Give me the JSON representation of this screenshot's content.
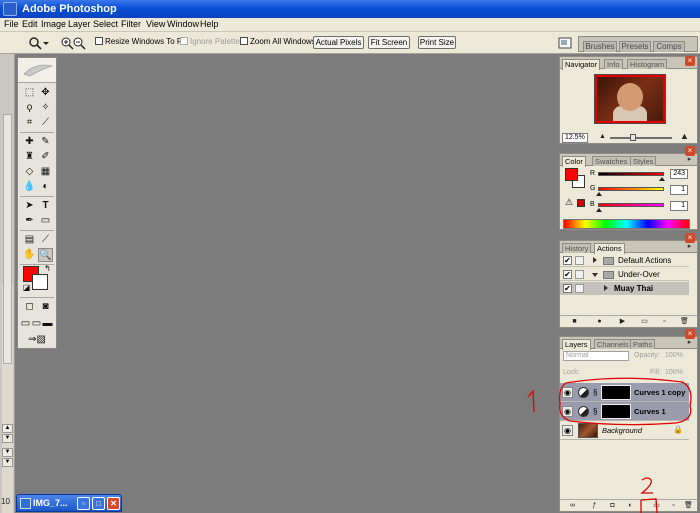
{
  "titlebar": {
    "title": "Adobe Photoshop"
  },
  "menu": [
    "File",
    "Edit",
    "Image",
    "Layer",
    "Select",
    "Filter",
    "View",
    "Window",
    "Help"
  ],
  "options": {
    "resize_windows": "Resize Windows To Fit",
    "ignore_palettes": "Ignore Palettes",
    "zoom_all": "Zoom All Windows",
    "actual_pixels": "Actual Pixels",
    "fit_screen": "Fit Screen",
    "print_size": "Print Size"
  },
  "palette_well": {
    "tabs": [
      "Brushes",
      "Presets",
      "Comps"
    ]
  },
  "statusbar": {
    "zoom": "10"
  },
  "document": {
    "title": "IMG_7..."
  },
  "navigator": {
    "tabs": [
      "Navigator",
      "Info",
      "Histogram"
    ],
    "zoom": "12.5%"
  },
  "color": {
    "tabs": [
      "Color",
      "Swatches",
      "Styles"
    ],
    "r_label": "R",
    "g_label": "G",
    "b_label": "B",
    "r": "243",
    "g": "1",
    "b": "1",
    "fg": "#ff0000",
    "bg": "#ffffff"
  },
  "actions": {
    "tabs": [
      "History",
      "Actions"
    ],
    "rows": [
      {
        "label": "Default Actions"
      },
      {
        "label": "Under-Over"
      },
      {
        "label": "Muay Thai"
      }
    ]
  },
  "layers": {
    "tabs": [
      "Layers",
      "Channels",
      "Paths"
    ],
    "blend_mode": "Normal",
    "opacity_label": "Opacity:",
    "opacity": "100%",
    "lock_label": "Lock:",
    "fill_label": "Fill:",
    "fill": "100%",
    "rows": [
      {
        "name": "Curves 1 copy"
      },
      {
        "name": "Curves 1"
      },
      {
        "name": "Background"
      }
    ]
  },
  "annotations": {
    "one": "1",
    "two": "2",
    "color": "#e00000"
  }
}
